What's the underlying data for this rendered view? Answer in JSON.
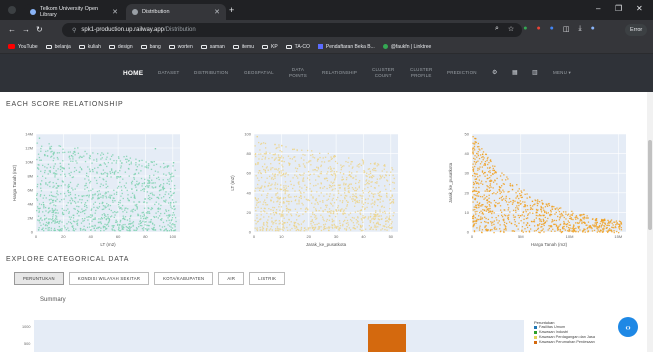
{
  "browser": {
    "tabs": [
      {
        "title": "Telkom University Open Library",
        "active": false
      },
      {
        "title": "Distribution",
        "active": true
      }
    ],
    "new_tab_glyph": "+",
    "window_controls": [
      "–",
      "❐",
      "✕"
    ],
    "url_host": "spk1-production.up.railway.app",
    "url_path": "/Distribution",
    "profile_label": "Error",
    "bookmarks": [
      {
        "label": "YouTube",
        "icon": "youtube-icon"
      },
      {
        "label": "belanja",
        "icon": "folder-icon"
      },
      {
        "label": "kuliah",
        "icon": "folder-icon"
      },
      {
        "label": "design",
        "icon": "folder-icon"
      },
      {
        "label": "bang",
        "icon": "folder-icon"
      },
      {
        "label": "worten",
        "icon": "folder-icon"
      },
      {
        "label": "saman",
        "icon": "folder-icon"
      },
      {
        "label": "itemu",
        "icon": "folder-icon"
      },
      {
        "label": "KP",
        "icon": "folder-icon"
      },
      {
        "label": "TA-CO",
        "icon": "folder-icon"
      },
      {
        "label": "Pendaftaran Beka B...",
        "icon": "page-icon"
      },
      {
        "label": "@faukfn | Linktree",
        "icon": "linktree-icon"
      }
    ]
  },
  "site_nav": {
    "home": "HOME",
    "items": [
      "DATASET",
      "DISTRIBUTION",
      "GEOSPATIAL",
      "DATA\nPOINTS",
      "RELATIONSHIP",
      "CLUSTER\nCOUNT",
      "CLUSTER\nPROFILE",
      "PREDICTION"
    ],
    "glyphs": [
      "⚙",
      "▦",
      "▥"
    ],
    "menu": "MENU"
  },
  "relationship_title": "EACH SCORE RELATIONSHIP",
  "categorical_title": "EXPLORE CATEGORICAL DATA",
  "categorical_tabs": [
    {
      "label": "PERUNTUKAN",
      "active": true
    },
    {
      "label": "KONDISI WILAYAH SEKITAR",
      "active": false
    },
    {
      "label": "KOTA/KABUPATEN",
      "active": false
    },
    {
      "label": "AIR",
      "active": false
    },
    {
      "label": "LISTRIK",
      "active": false
    }
  ],
  "summary_label": "Summary",
  "fab_glyph": "‹›",
  "chart_data": [
    {
      "type": "scatter",
      "color": "#7fd1b0",
      "xlabel": "LT (m2)",
      "ylabel": "Harga Tanah (m2)",
      "xticks": [
        "0",
        "20",
        "40",
        "60",
        "80",
        "100"
      ],
      "yticks": [
        "0",
        "2M",
        "4M",
        "6M",
        "8M",
        "10M",
        "12M",
        "14M"
      ],
      "xlim": [
        0,
        100
      ],
      "ylim": [
        0,
        14
      ],
      "shape": "dense-flat",
      "sample_points": [
        [
          2,
          13.5
        ],
        [
          10,
          12
        ],
        [
          25,
          11
        ],
        [
          40,
          9
        ],
        [
          60,
          8
        ],
        [
          85,
          12
        ],
        [
          98,
          10
        ],
        [
          5,
          4
        ],
        [
          30,
          3
        ],
        [
          70,
          5
        ]
      ]
    },
    {
      "type": "scatter",
      "color": "#ecd48a",
      "xlabel": "Jarak_ke_pusatkota",
      "ylabel": "LT (m2)",
      "xticks": [
        "0",
        "10",
        "20",
        "30",
        "40",
        "50"
      ],
      "yticks": [
        "0",
        "20",
        "40",
        "60",
        "80",
        "100"
      ],
      "xlim": [
        0,
        55
      ],
      "ylim": [
        0,
        100
      ],
      "shape": "dense-flat",
      "sample_points": [
        [
          1,
          98
        ],
        [
          8,
          90
        ],
        [
          15,
          85
        ],
        [
          25,
          75
        ],
        [
          35,
          60
        ],
        [
          45,
          50
        ],
        [
          52,
          40
        ],
        [
          5,
          10
        ],
        [
          30,
          20
        ]
      ]
    },
    {
      "type": "scatter",
      "color": "#f0a020",
      "xlabel": "Harga Tanah (m2)",
      "ylabel": "Jarak_ke_pusatkota",
      "xticks": [
        "0",
        "5M",
        "10M",
        "15M"
      ],
      "yticks": [
        "0",
        "10",
        "20",
        "30",
        "40",
        "50"
      ],
      "xlim": [
        0,
        15
      ],
      "ylim": [
        0,
        50
      ],
      "shape": "decay",
      "sample_points": [
        [
          0.3,
          48
        ],
        [
          1,
          40
        ],
        [
          2,
          30
        ],
        [
          4,
          22
        ],
        [
          6,
          16
        ],
        [
          8,
          12
        ],
        [
          10,
          9
        ],
        [
          13,
          6
        ],
        [
          14.5,
          5
        ]
      ]
    }
  ],
  "bottom_chart": {
    "type": "bar",
    "color": "#d4690e",
    "yticks": [
      "1000",
      "500"
    ]
  },
  "legend": {
    "title": "Peruntukan",
    "entries": [
      {
        "label": "Fasilitas Umum",
        "color": "#1f77b4"
      },
      {
        "label": "Kawasan Industri",
        "color": "#2ca02c"
      },
      {
        "label": "Kawasan Perdagangan dan Jasa",
        "color": "#e3d25a"
      },
      {
        "label": "Kawasan Perumahan Perdesaan",
        "color": "#d4690e"
      }
    ]
  }
}
